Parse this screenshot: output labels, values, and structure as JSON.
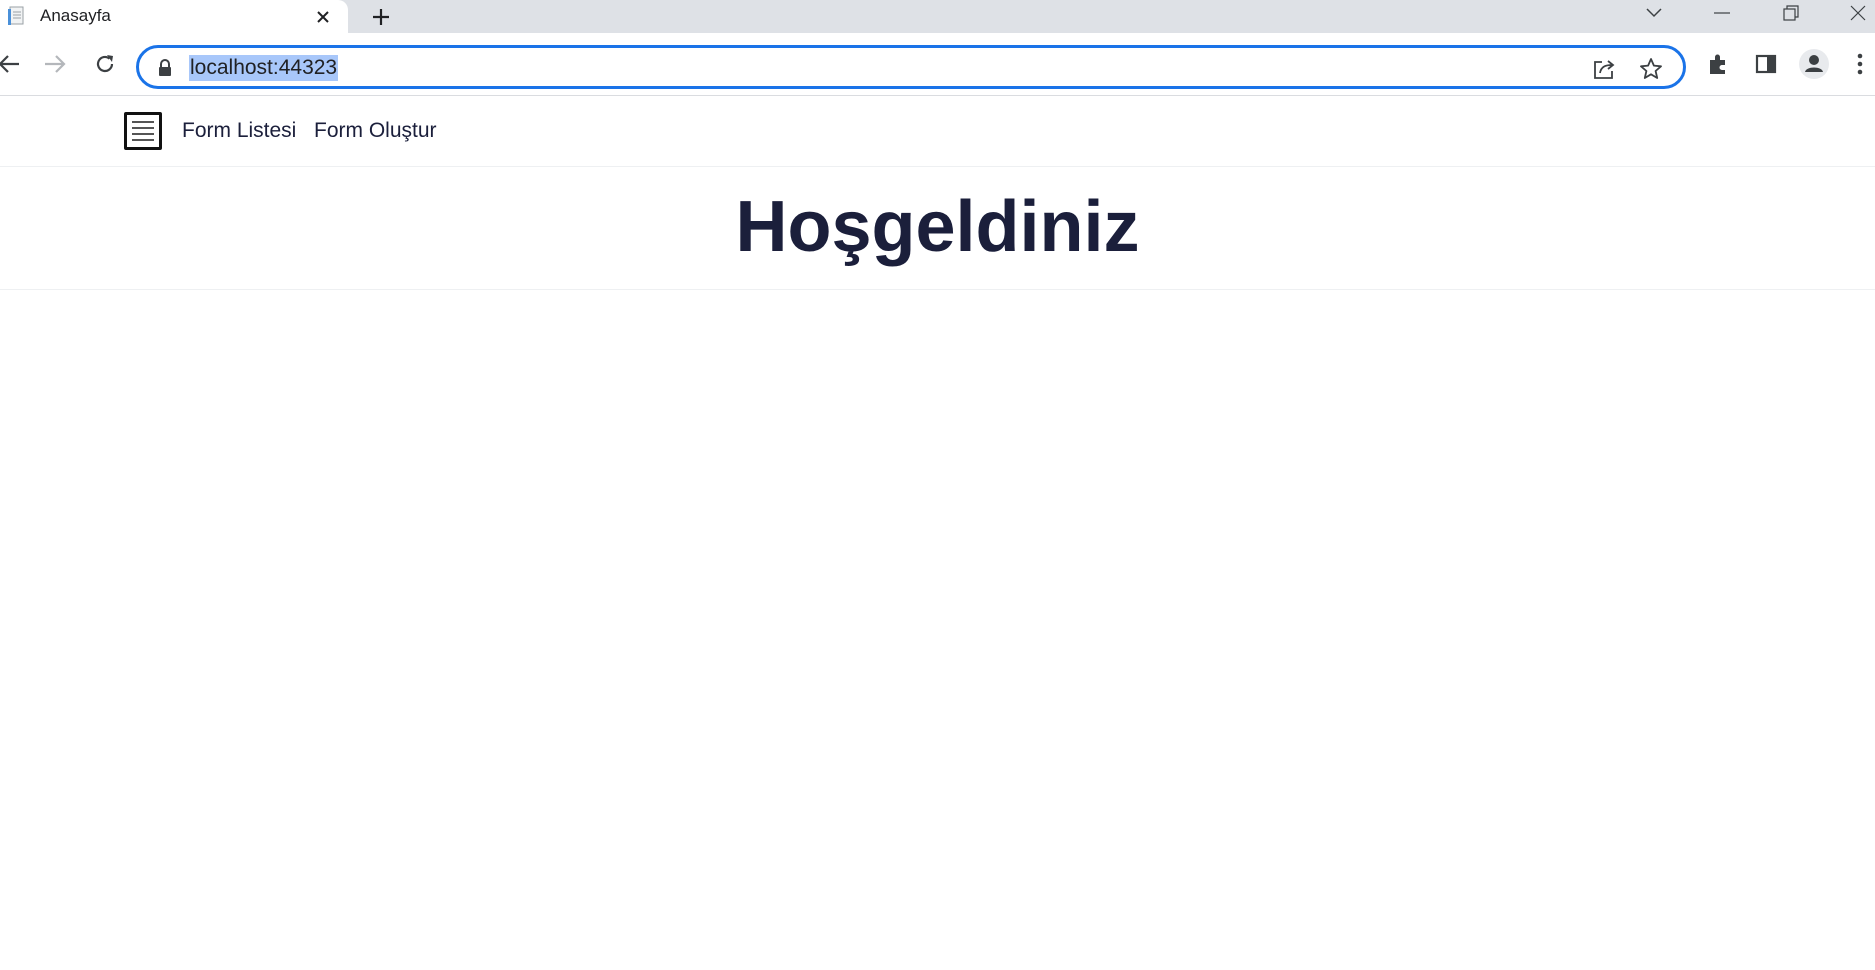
{
  "browser": {
    "tab": {
      "title": "Anasayfa",
      "favicon": "document-icon"
    },
    "window_controls": [
      "tab-search-icon",
      "minimize-icon",
      "restore-icon",
      "close-window-icon"
    ],
    "toolbar": {
      "url": "localhost:44323",
      "url_selected": true,
      "icons": [
        "back-icon",
        "forward-icon",
        "reload-icon",
        "lock-icon",
        "share-icon",
        "bookmark-star-icon",
        "extensions-icon",
        "side-panel-icon",
        "profile-icon",
        "menu-icon"
      ]
    },
    "colors": {
      "omnibox_focus": "#1a73e8",
      "selection": "#a8c7fa",
      "tabstrip": "#dee1e6"
    }
  },
  "page": {
    "nav": {
      "menu_icon": "hamburger-icon",
      "links": [
        {
          "label": "Form Listesi"
        },
        {
          "label": "Form Oluştur"
        }
      ]
    },
    "heading": "Hoşgeldiniz",
    "colors": {
      "text": "#1b1f3b"
    }
  }
}
